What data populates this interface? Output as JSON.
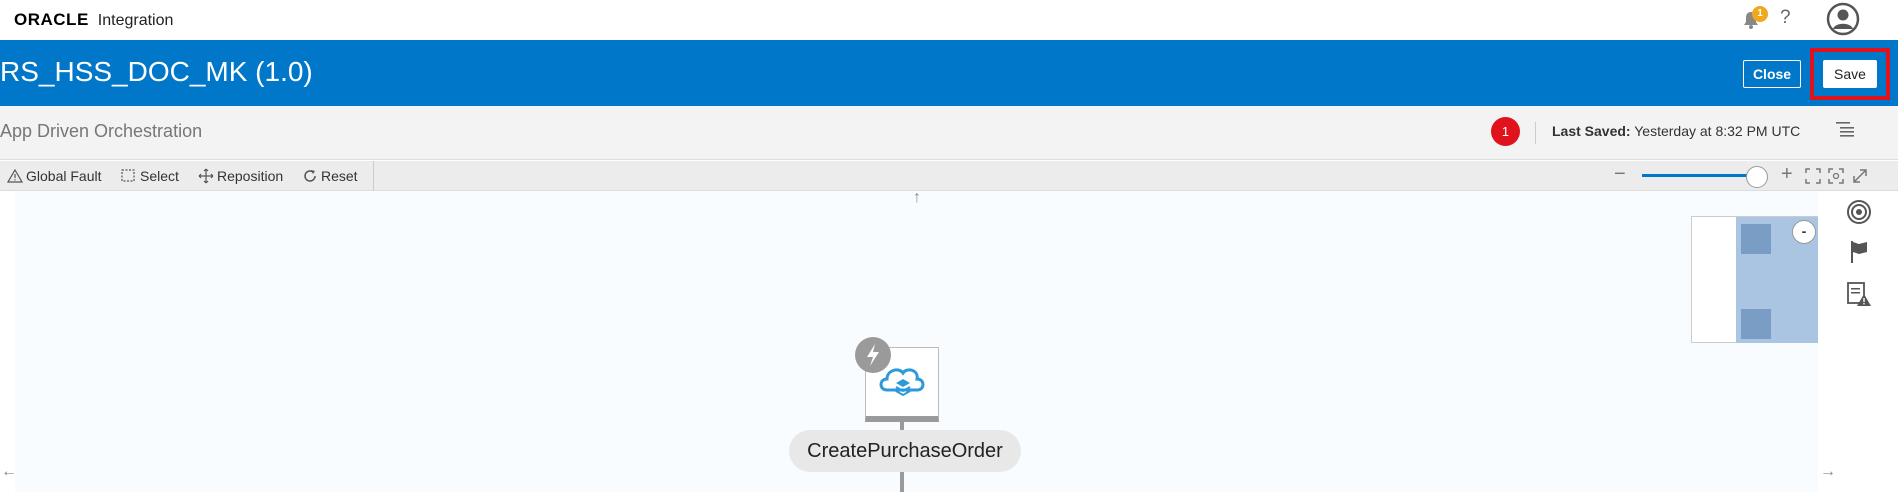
{
  "topbar": {
    "brand": "ORACLE",
    "product": "Integration",
    "notification_count": "1",
    "help_label": "?"
  },
  "header": {
    "title": "RS_HSS_DOC_MK (1.0)",
    "close_label": "Close",
    "save_label": "Save"
  },
  "subheader": {
    "subtitle": "App Driven Orchestration",
    "error_count": "1",
    "last_saved_label": "Last Saved:",
    "last_saved_value": "Yesterday at 8:32 PM UTC"
  },
  "toolbar": {
    "global_fault": "Global Fault",
    "select": "Select",
    "reposition": "Reposition",
    "reset": "Reset",
    "zoom_level_fraction": 0.92
  },
  "canvas": {
    "node_label": "CreatePurchaseOrder",
    "minimap_collapse": "-"
  },
  "colors": {
    "header_blue": "#0077c8",
    "error_red": "#e0121c",
    "notification_orange": "#f0a81c"
  }
}
